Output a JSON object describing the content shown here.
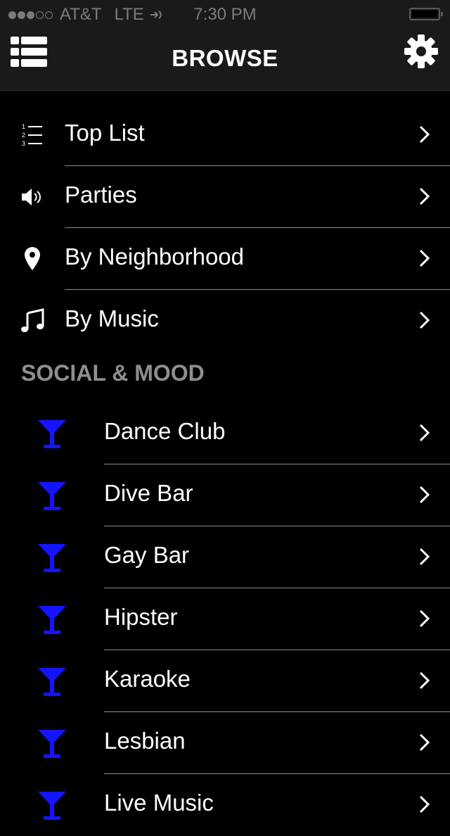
{
  "status_bar": {
    "carrier": "AT&T",
    "network": "LTE",
    "time": "7:30 PM"
  },
  "nav": {
    "title": "BROWSE"
  },
  "main_items": [
    {
      "label": "Top List",
      "icon": "numbered-list-icon"
    },
    {
      "label": "Parties",
      "icon": "speaker-icon"
    },
    {
      "label": "By Neighborhood",
      "icon": "location-pin-icon"
    },
    {
      "label": "By Music",
      "icon": "music-note-icon"
    }
  ],
  "section": {
    "title": "SOCIAL & MOOD"
  },
  "mood_items": [
    {
      "label": "Dance Club",
      "icon": "cocktail-glass-icon"
    },
    {
      "label": "Dive Bar",
      "icon": "cocktail-glass-icon"
    },
    {
      "label": "Gay Bar",
      "icon": "cocktail-glass-icon"
    },
    {
      "label": "Hipster",
      "icon": "cocktail-glass-icon"
    },
    {
      "label": "Karaoke",
      "icon": "cocktail-glass-icon"
    },
    {
      "label": "Lesbian",
      "icon": "cocktail-glass-icon"
    },
    {
      "label": "Live Music",
      "icon": "cocktail-glass-icon"
    }
  ],
  "colors": {
    "background": "#000000",
    "bar": "#1a1a1a",
    "accent_glass": "#1414ff",
    "section_text": "#8e8e93"
  }
}
